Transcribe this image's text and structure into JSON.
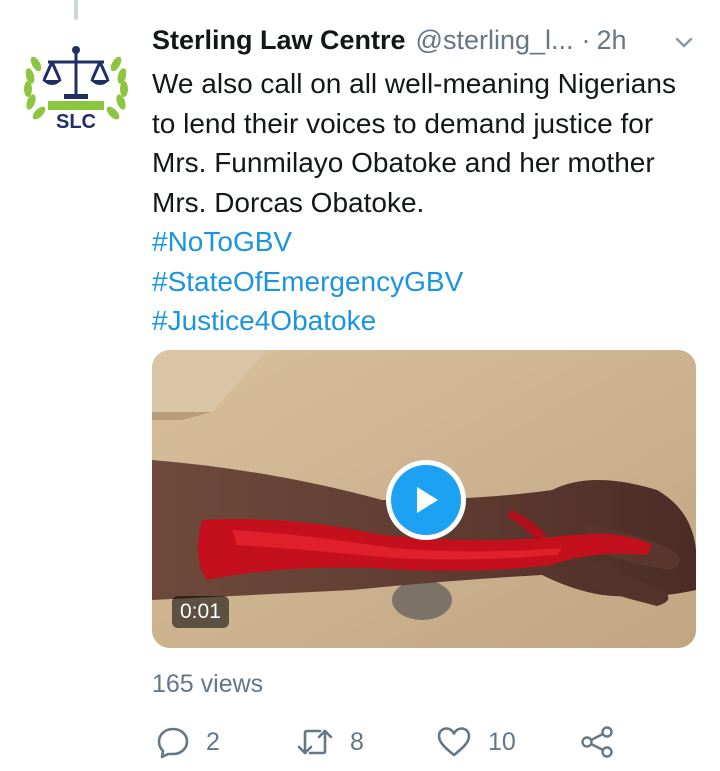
{
  "tweet": {
    "author_name": "Sterling Law Centre",
    "handle": "@sterling_l...",
    "separator": "·",
    "time": "2h",
    "text": "We also call on all well-meaning Nigerians to lend their voices to demand justice for Mrs. Funmilayo Obatoke and her mother Mrs. Dorcas Obatoke.",
    "hashtags": [
      "#NoToGBV",
      "#StateOfEmergencyGBV",
      "#Justice4Obatoke"
    ],
    "avatar_text": "SLC",
    "video": {
      "duration": "0:01"
    },
    "views": "165 views",
    "actions": {
      "replies": "2",
      "retweets": "8",
      "likes": "10"
    }
  },
  "icons": [
    "chevron-down-icon",
    "play-icon",
    "reply-icon",
    "retweet-icon",
    "like-icon",
    "share-icon"
  ],
  "colors": {
    "link": "#1b95e0",
    "secondary": "#657786",
    "play_button": "#1da1f2",
    "logo_green": "#8cc63f",
    "logo_navy": "#1f2f63"
  }
}
